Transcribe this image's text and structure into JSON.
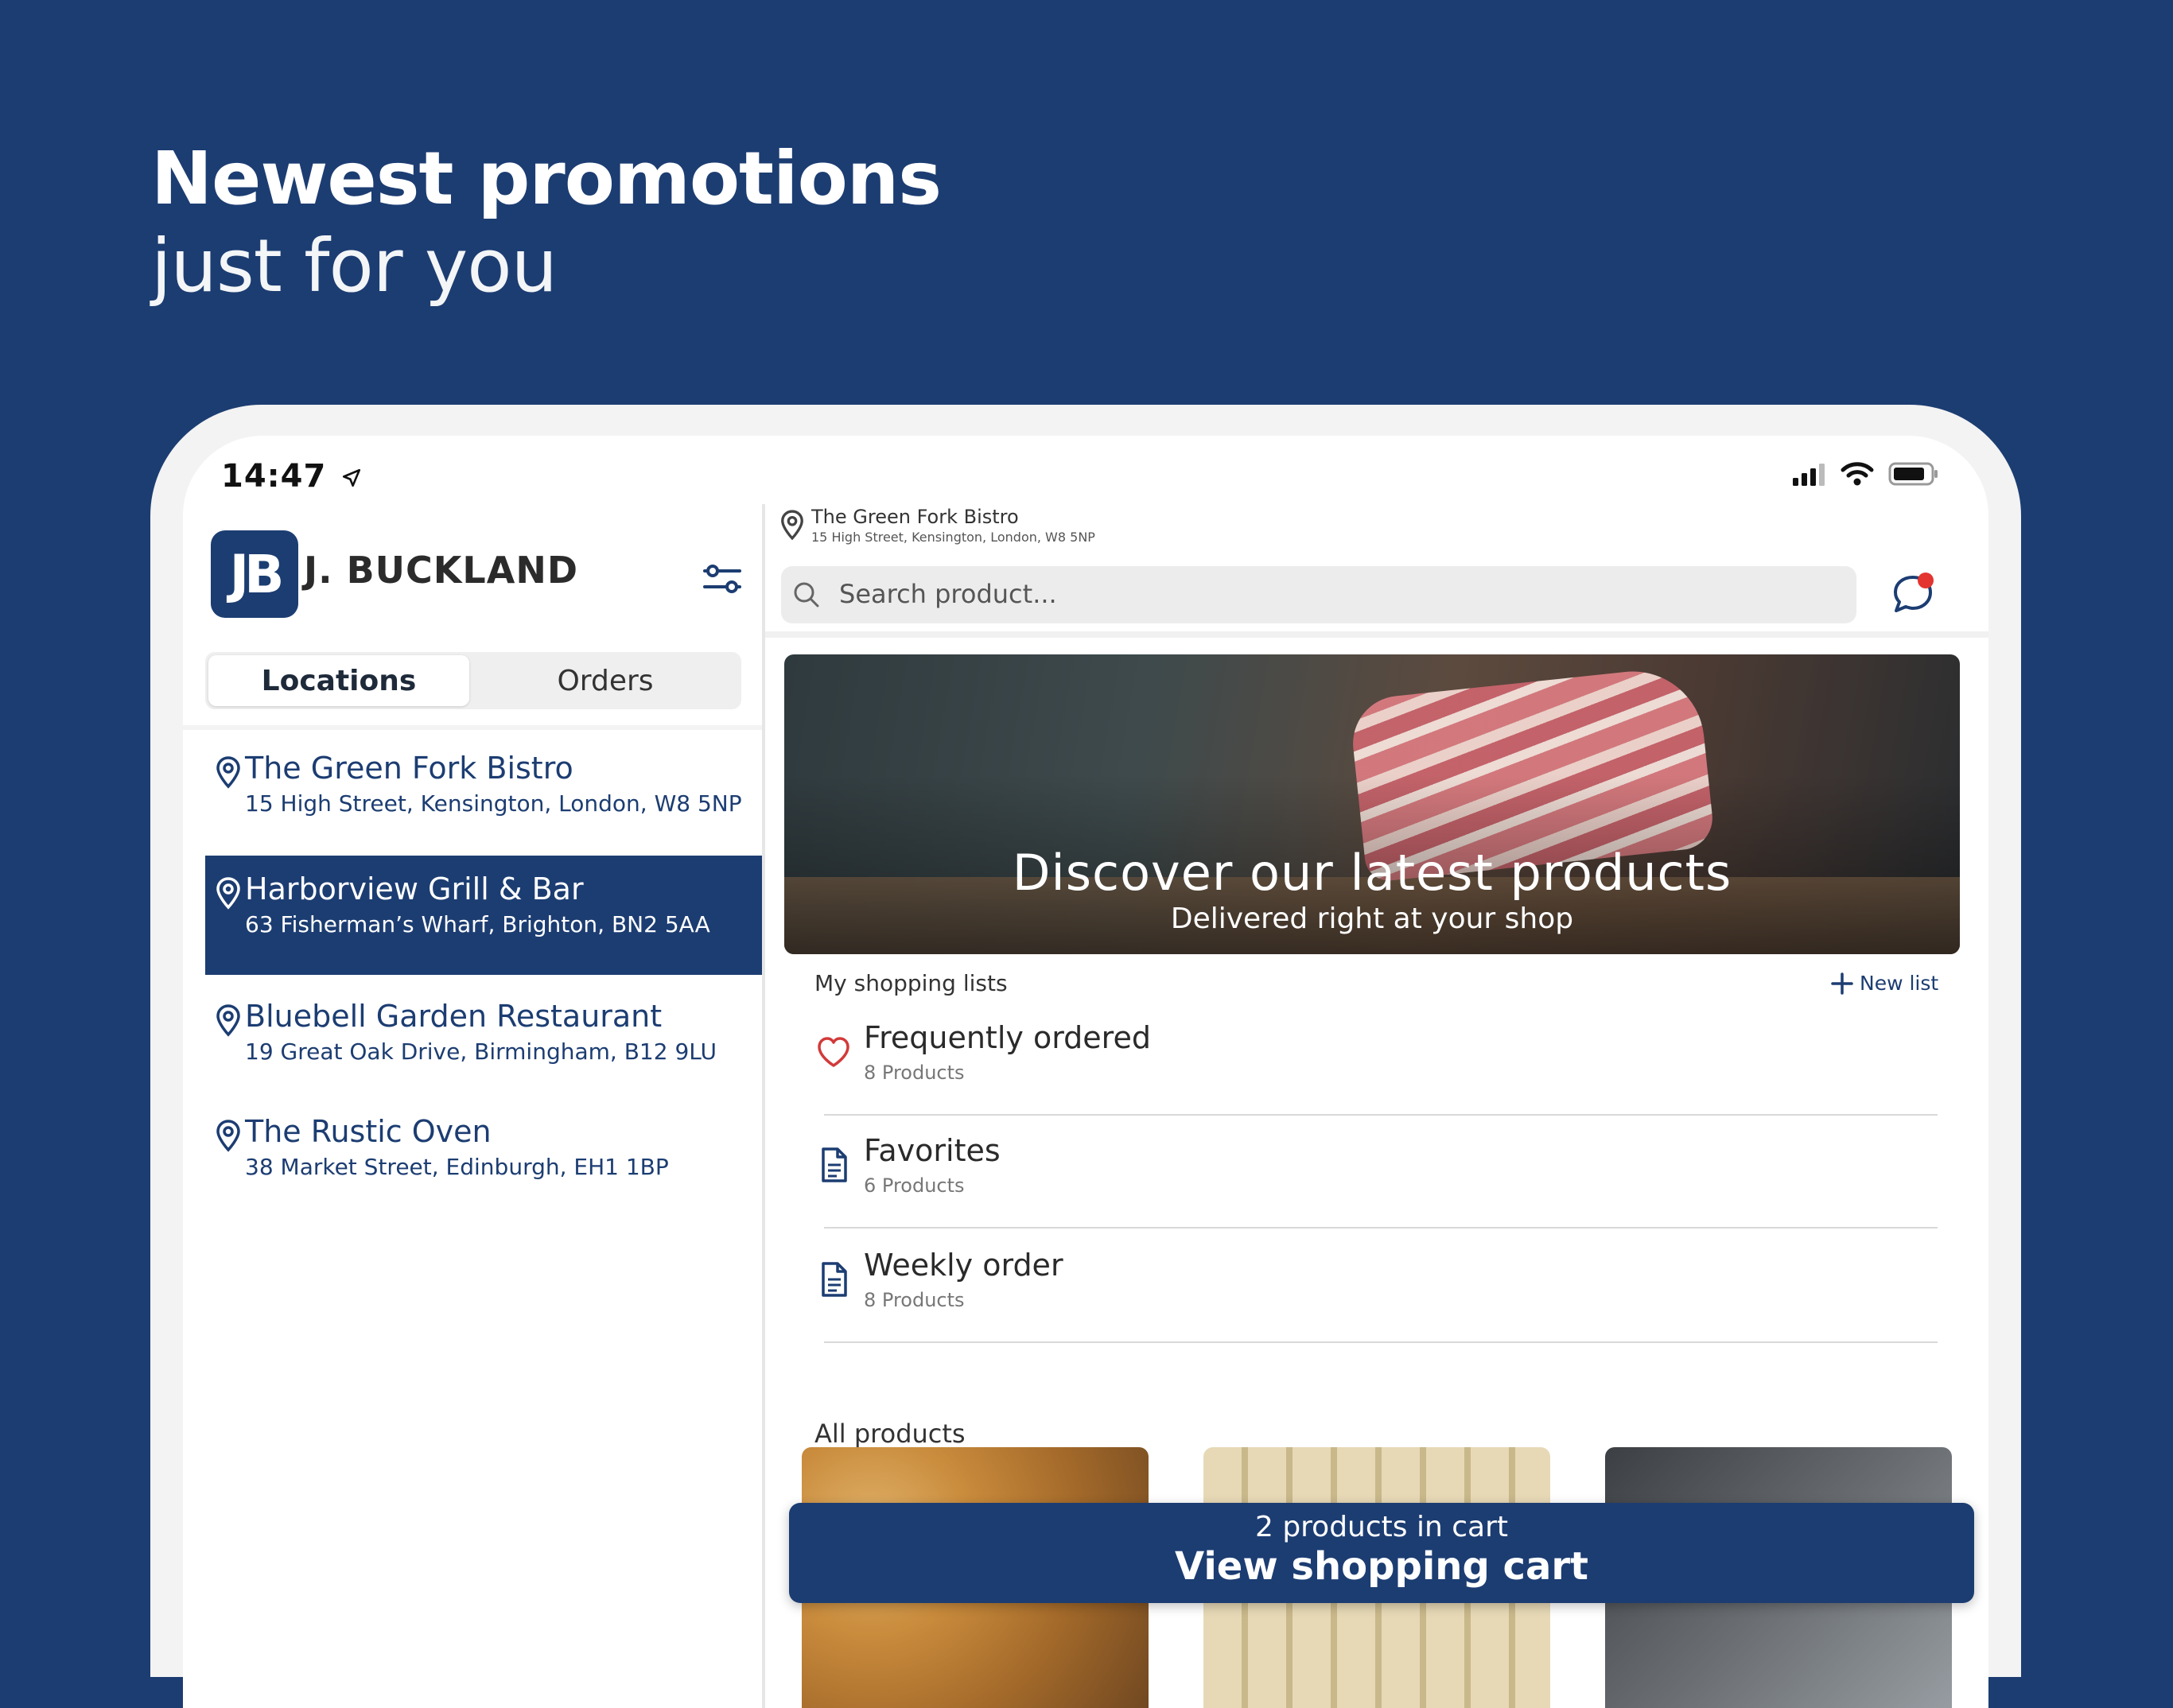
{
  "hero": {
    "line1": "Newest promotions",
    "line2": "just for you"
  },
  "status": {
    "time": "14:47"
  },
  "brand": {
    "logo": "JB",
    "name": "J. BUCKLAND"
  },
  "tabs": [
    {
      "label": "Locations",
      "active": true
    },
    {
      "label": "Orders",
      "active": false
    }
  ],
  "locations": [
    {
      "name": "The Green Fork Bistro",
      "address": "15 High Street, Kensington, London, W8 5NP",
      "selected": false
    },
    {
      "name": "Harborview Grill & Bar",
      "address": "63 Fisherman’s Wharf, Brighton, BN2 5AA",
      "selected": true
    },
    {
      "name": "Bluebell Garden Restaurant",
      "address": "19 Great Oak Drive, Birmingham, B12 9LU",
      "selected": false
    },
    {
      "name": "The Rustic Oven",
      "address": "38 Market Street, Edinburgh, EH1 1BP",
      "selected": false
    }
  ],
  "current_location": {
    "name": "The Green Fork Bistro",
    "address": "15 High Street, Kensington, London, W8 5NP"
  },
  "search": {
    "placeholder": "Search product..."
  },
  "banner": {
    "title": "Discover our latest products",
    "subtitle": "Delivered right at your shop"
  },
  "shopping_lists": {
    "heading": "My shopping lists",
    "new_list_label": "New list",
    "items": [
      {
        "title": "Frequently ordered",
        "count": "8 Products",
        "icon": "heart-icon"
      },
      {
        "title": "Favorites",
        "count": "6 Products",
        "icon": "document-icon"
      },
      {
        "title": "Weekly order",
        "count": "8 Products",
        "icon": "document-icon"
      }
    ]
  },
  "all_products": {
    "heading": "All products"
  },
  "cart": {
    "count_text": "2 products in cart",
    "button_label": "View shopping cart"
  },
  "colors": {
    "brand_navy": "#1c3d72",
    "notification_red": "#e3342f",
    "heart_red": "#d23a3a"
  }
}
